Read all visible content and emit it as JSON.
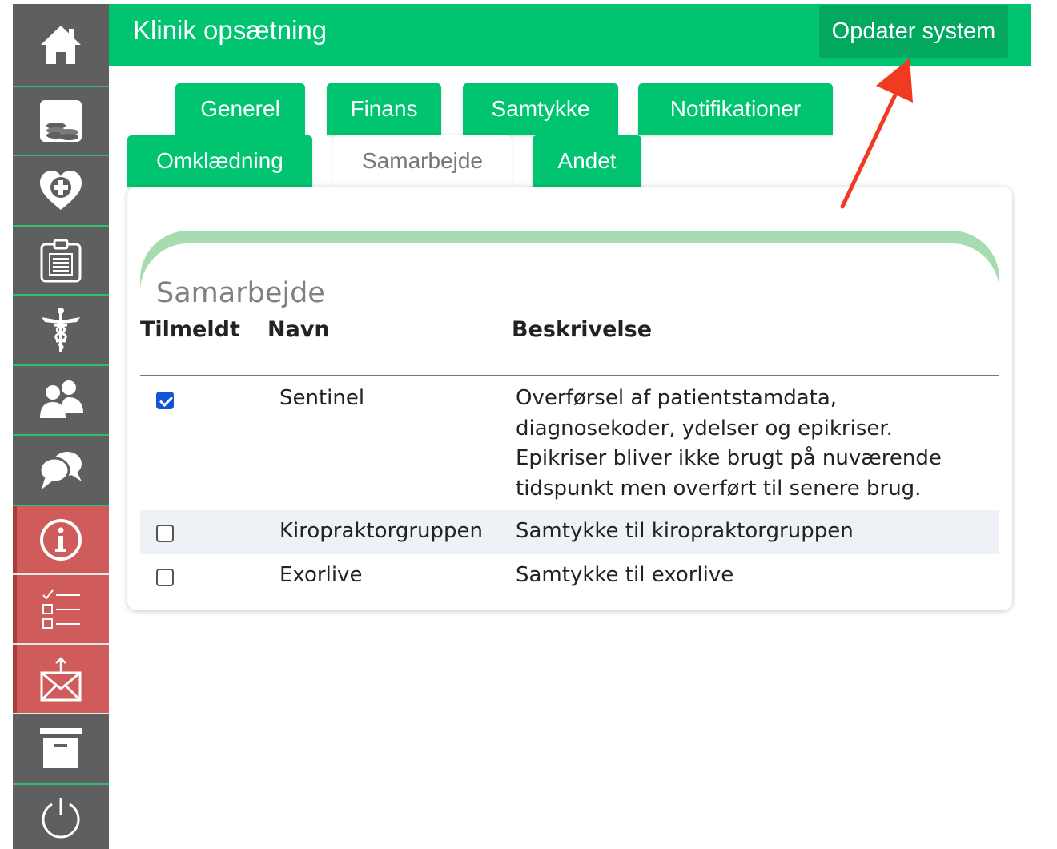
{
  "header": {
    "title": "Klinik opsætning",
    "update_button": "Opdater system"
  },
  "sidebar": {
    "items": [
      {
        "icon": "home-icon"
      },
      {
        "icon": "coins-icon"
      },
      {
        "icon": "heart-plus-icon"
      },
      {
        "icon": "clipboard-icon"
      },
      {
        "icon": "caduceus-icon"
      },
      {
        "icon": "users-icon"
      },
      {
        "icon": "chat-bubbles-icon"
      },
      {
        "icon": "info-icon",
        "highlight": true
      },
      {
        "icon": "checklist-icon",
        "highlight": true
      },
      {
        "icon": "mail-upload-icon",
        "highlight": true
      },
      {
        "icon": "archive-icon"
      },
      {
        "icon": "power-icon"
      }
    ]
  },
  "tabs": {
    "row1": [
      "Generel",
      "Finans",
      "Samtykke",
      "Notifikationer"
    ],
    "row2": [
      "Omklædning",
      "Samarbejde",
      "Andet"
    ],
    "active": "Samarbejde"
  },
  "section": {
    "title": "Samarbejde",
    "columns": {
      "enrolled": "Tilmeldt",
      "name": "Navn",
      "description": "Beskrivelse"
    },
    "rows": [
      {
        "checked": true,
        "name": "Sentinel",
        "description": "Overførsel af patientstamdata,\ndiagnosekoder, ydelser og epikriser.\nEpikriser bliver ikke brugt på nuværende\ntidspunkt men overført til senere brug."
      },
      {
        "checked": false,
        "name": "Kiropraktorgruppen",
        "description": "Samtykke til kiropraktorgruppen"
      },
      {
        "checked": false,
        "name": "Exorlive",
        "description": "Samtykke til exorlive"
      }
    ]
  },
  "colors": {
    "brand_green": "#00c46f",
    "sidebar_gray": "#5f5f5f",
    "alert_red": "#cf5c5a",
    "annotation_arrow": "#f03a22"
  }
}
